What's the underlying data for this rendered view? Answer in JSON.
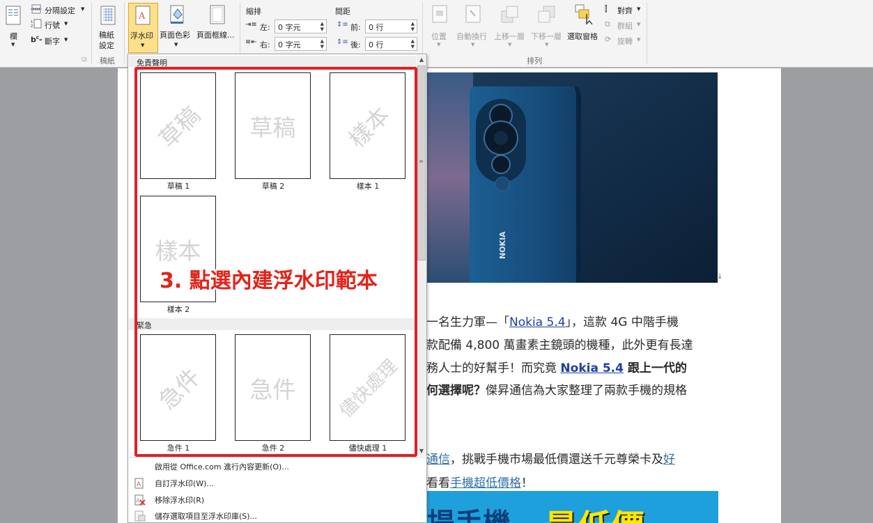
{
  "ribbon": {
    "columns_label": "欄",
    "breaks_label": "分隔設定",
    "line_numbers_label": "行號",
    "hyphenation_label": "斷字",
    "manuscript_label": "稿紙\n設定",
    "manuscript_group": "稿紙",
    "watermark_label": "浮水印",
    "page_color_label": "頁面色彩",
    "page_borders_label": "頁面框線...",
    "indent_title": "縮排",
    "indent_left_label": "左:",
    "indent_left_value": "0 字元",
    "indent_right_label": "右:",
    "indent_right_value": "0 字元",
    "spacing_title": "間距",
    "spacing_before_label": "前:",
    "spacing_before_value": "0 行",
    "spacing_after_label": "後:",
    "spacing_after_value": "0 行",
    "position_label": "位置",
    "wrap_text_label": "自動換行",
    "bring_forward_label": "上移一層",
    "send_backward_label": "下移一層",
    "selection_pane_label": "選取窗格",
    "align_label": "對齊",
    "group_label": "群組",
    "rotate_label": "旋轉",
    "arrange_group": "排列"
  },
  "gallery": {
    "section1": "免責聲明",
    "section2": "緊急",
    "items": [
      {
        "watermark": "草稿",
        "caption": "草稿 1"
      },
      {
        "watermark": "草稿",
        "caption": "草稿 2"
      },
      {
        "watermark": "樣本",
        "caption": "樣本 1"
      },
      {
        "watermark": "樣本",
        "caption": "樣本 2"
      },
      {
        "watermark": "急件",
        "caption": "急件 1"
      },
      {
        "watermark": "急件",
        "caption": "急件 2"
      },
      {
        "watermark": "儘快處理",
        "caption": "儘快處理 1"
      }
    ],
    "menu": {
      "office_update": "啟用從 Office.com 進行內容更新(O)...",
      "custom": "自訂浮水印(W)...",
      "remove": "移除浮水印(R)",
      "save": "儲存選取項目至浮水印庫(S)..."
    }
  },
  "annotation": "3. 點選內建浮水印範本",
  "document": {
    "photo_brand": "NOKIA",
    "line1_pre": "一名生力軍—「",
    "line1_link": "Nokia 5.4",
    "line1_post": "」，這款 4G 中階手機",
    "line2": "款配備 4,800 萬畫素主鏡頭的機種，此外更有長達",
    "line3_pre": "務人士的好幫手！而究竟 ",
    "line3_link": "Nokia 5.4",
    "line3_post": " 跟上一代的",
    "line4_bold": "何選擇呢？",
    "line4_rest": "傑昇通信為大家整理了兩款手機的規格",
    "line5_link1": "通信",
    "line5_mid": "，挑戰手機市場最低價還送千元尊榮卡及",
    "line5_link2": "好",
    "line6_pre": "看看",
    "line6_link": "手機超低價格",
    "line6_post": "！",
    "banner_text1": "提手機",
    "banner_text2": "最低價"
  }
}
